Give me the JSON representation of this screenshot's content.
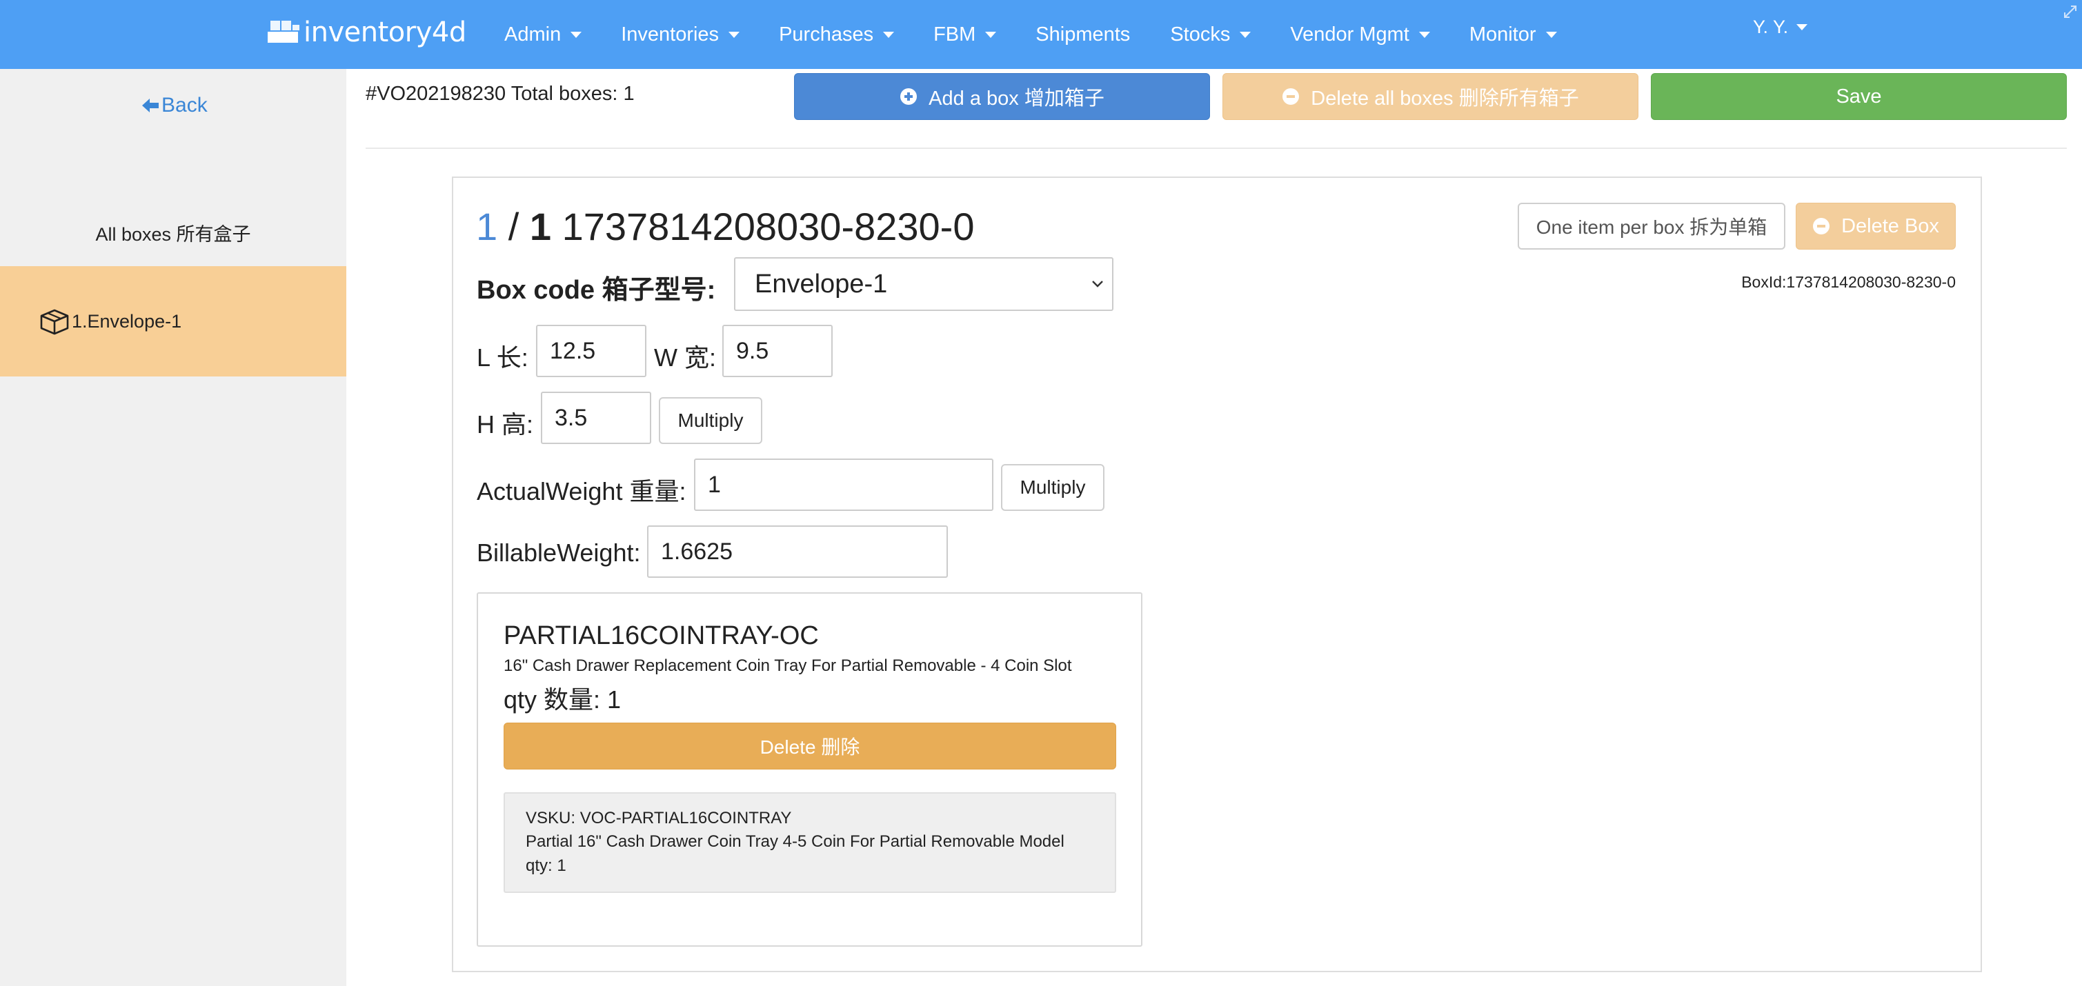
{
  "navbar": {
    "brand": "inventory4d",
    "menu": [
      {
        "label": "Admin",
        "dropdown": true
      },
      {
        "label": "Inventories",
        "dropdown": true
      },
      {
        "label": "Purchases",
        "dropdown": true
      },
      {
        "label": "FBM",
        "dropdown": true
      },
      {
        "label": "Shipments",
        "dropdown": false
      },
      {
        "label": "Stocks",
        "dropdown": true
      },
      {
        "label": "Vendor Mgmt",
        "dropdown": true
      },
      {
        "label": "Monitor",
        "dropdown": true
      }
    ],
    "user": "Y. Y."
  },
  "sidebar": {
    "back_label": "Back",
    "all_boxes_label": "All boxes 所有盒子",
    "boxes": [
      {
        "label": "1.Envelope-1",
        "active": true
      }
    ]
  },
  "toolbar": {
    "order_title": "#VO202198230 Total boxes: 1",
    "add_box_label": "Add a box 增加箱子",
    "delete_all_label": "Delete all boxes 删除所有箱子",
    "save_label": "Save"
  },
  "box": {
    "current_index": "1",
    "separator": "/",
    "total": "1",
    "box_name": "1737814208030-8230-0",
    "one_item_label": "One item per box 拆为单箱",
    "delete_box_label": "Delete Box",
    "box_id_text": "BoxId:1737814208030-8230-0",
    "box_code_label": "Box code 箱子型号:",
    "box_code_value": "Envelope-1",
    "length_label": "L 长:",
    "length_value": "12.5",
    "width_label": "W 宽:",
    "width_value": "9.5",
    "height_label": "H 高:",
    "height_value": "3.5",
    "multiply_label": "Multiply",
    "actual_weight_label": "ActualWeight 重量:",
    "actual_weight_value": "1",
    "billable_weight_label": "BillableWeight:",
    "billable_weight_value": "1.6625"
  },
  "item": {
    "sku": "PARTIAL16COINTRAY-OC",
    "description": "16\" Cash Drawer Replacement Coin Tray For Partial Removable - 4 Coin Slot",
    "qty_text": "qty 数量: 1",
    "delete_label": "Delete 删除",
    "vsku_line": "VSKU: VOC-PARTIAL16COINTRAY",
    "vsku_desc": "Partial 16\" Cash Drawer Coin Tray 4-5 Coin For Partial Removable Model",
    "vsku_qty": "qty: 1"
  },
  "colors": {
    "navbar": "#4e9ff4",
    "primary": "#4c89d6",
    "warning_light": "#f3ce9c",
    "warning": "#e8ad57",
    "success": "#6ab558",
    "sidebar_active": "#f8cf96"
  },
  "icons": [
    "logo-icon",
    "back-arrow-icon",
    "box-icon",
    "plus-circle-icon",
    "minus-circle-icon",
    "chevron-down-icon",
    "resize-icon"
  ]
}
